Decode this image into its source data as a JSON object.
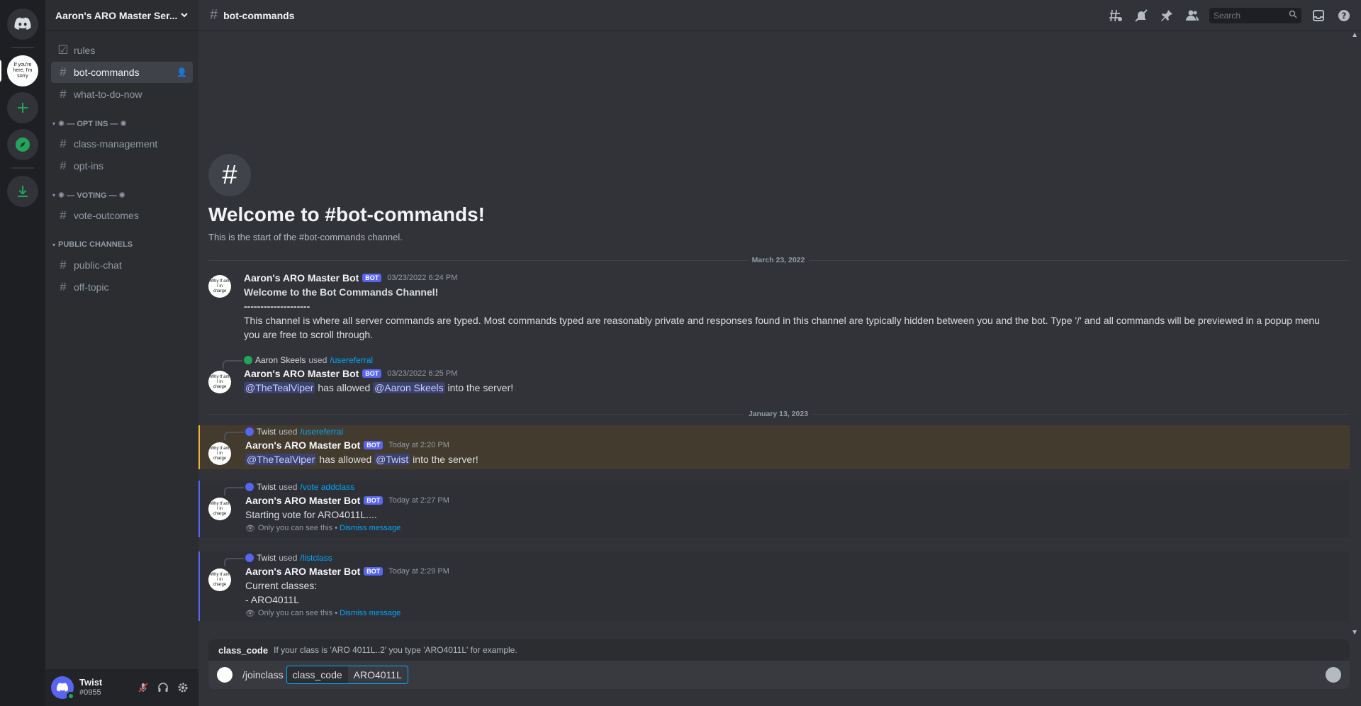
{
  "server": {
    "name": "Aaron's ARO Master Ser...",
    "icon_text": "If you're here, I'm sorry"
  },
  "channels_top": [
    {
      "name": "rules",
      "icon": "rules-icon",
      "active": false
    },
    {
      "name": "bot-commands",
      "icon": "hash-icon",
      "active": true
    },
    {
      "name": "what-to-do-now",
      "icon": "hash-icon",
      "active": false
    }
  ],
  "categories": [
    {
      "label": "✺ — OPT INS — ✺",
      "channels": [
        "class-management",
        "opt-ins"
      ]
    },
    {
      "label": "✺ — VOTING — ✺",
      "channels": [
        "vote-outcomes"
      ]
    },
    {
      "label": "PUBLIC CHANNELS",
      "channels": [
        "public-chat",
        "off-topic"
      ]
    }
  ],
  "user": {
    "name": "Twist",
    "discriminator": "#0955"
  },
  "topbar": {
    "channel": "bot-commands",
    "search_placeholder": "Search"
  },
  "welcome": {
    "title": "Welcome to #bot-commands!",
    "subtitle": "This is the start of the #bot-commands channel."
  },
  "dates": {
    "d1": "March 23, 2022",
    "d2": "January 13, 2023"
  },
  "bot": {
    "name": "Aaron's ARO Master Bot",
    "tag": "BOT",
    "avatar_text": "Why tf am I in charge"
  },
  "messages": {
    "m1": {
      "ts": "03/23/2022 6:24 PM",
      "line1": "Welcome to the Bot Commands Channel!",
      "line2": "--------------------",
      "line3": "This channel is where all server commands are typed. Most commands typed are reasonably private and responses found in this channel are typically hidden between you and the bot. Type '/' and all commands will be previewed in a popup menu you are free to scroll through."
    },
    "m2": {
      "reply_user": "Aaron Skeels",
      "reply_used": "used",
      "reply_cmd": "/usereferral",
      "ts": "03/23/2022 6:25 PM",
      "mention1": "@TheTealViper",
      "text_mid": "has allowed",
      "mention2": "@Aaron Skeels",
      "text_end": "into the server!"
    },
    "m3": {
      "reply_user": "Twist",
      "reply_used": "used",
      "reply_cmd": "/usereferral",
      "ts": "Today at 2:20 PM",
      "mention1": "@TheTealViper",
      "text_mid": "has allowed",
      "mention2": "@Twist",
      "text_end": "into the server!"
    },
    "m4": {
      "reply_user": "Twist",
      "reply_used": "used",
      "reply_cmd": "/vote addclass",
      "ts": "Today at 2:27 PM",
      "text": "Starting vote for ARO4011L....",
      "note": "Only you can see this •",
      "dismiss": "Dismiss message"
    },
    "m5": {
      "reply_user": "Twist",
      "reply_used": "used",
      "reply_cmd": "/listclass",
      "ts": "Today at 2:29 PM",
      "line1": "Current classes:",
      "line2": "- ARO4011L",
      "note": "Only you can see this •",
      "dismiss": "Dismiss message"
    }
  },
  "composer": {
    "hint_name": "class_code",
    "hint_text": "If your class is 'ARO 4011L..2' you type 'ARO4011L' for example.",
    "command": "/joinclass",
    "param_name": "class_code",
    "param_value": "ARO4011L"
  }
}
